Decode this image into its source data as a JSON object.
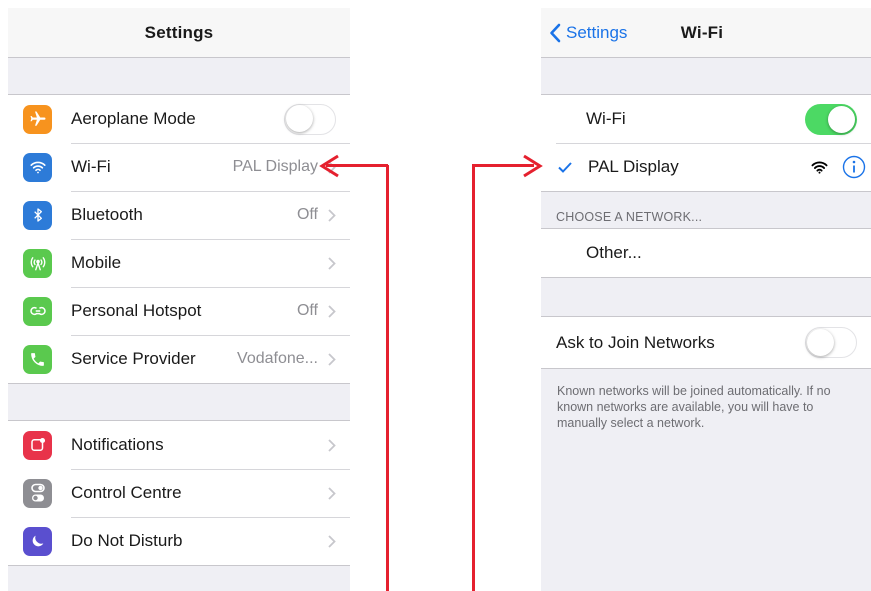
{
  "left": {
    "title": "Settings",
    "group1": [
      {
        "label": "Aeroplane Mode",
        "value": "",
        "icon": "airplane-icon",
        "color": "#f7931e",
        "control": "toggle-off"
      },
      {
        "label": "Wi-Fi",
        "value": "PAL Display",
        "icon": "wifi-icon",
        "color": "#2d7bd8",
        "control": "chevron"
      },
      {
        "label": "Bluetooth",
        "value": "Off",
        "icon": "bluetooth-icon",
        "color": "#2d7bd8",
        "control": "chevron"
      },
      {
        "label": "Mobile",
        "value": "",
        "icon": "antenna-icon",
        "color": "#5ac94e",
        "control": "chevron"
      },
      {
        "label": "Personal Hotspot",
        "value": "Off",
        "icon": "hotspot-icon",
        "color": "#5ac94e",
        "control": "chevron"
      },
      {
        "label": "Service Provider",
        "value": "Vodafone...",
        "icon": "phone-icon",
        "color": "#5ac94e",
        "control": "chevron"
      }
    ],
    "group2": [
      {
        "label": "Notifications",
        "value": "",
        "icon": "notifications-icon",
        "color": "#e8334a",
        "control": "chevron"
      },
      {
        "label": "Control Centre",
        "value": "",
        "icon": "switches-icon",
        "color": "#8e8e93",
        "control": "chevron"
      },
      {
        "label": "Do Not Disturb",
        "value": "",
        "icon": "moon-icon",
        "color": "#5a4fcf",
        "control": "chevron"
      }
    ]
  },
  "right": {
    "back_label": "Settings",
    "title": "Wi-Fi",
    "wifi_label": "Wi-Fi",
    "connected_network": "PAL Display",
    "choose_header": "CHOOSE A NETWORK...",
    "other_label": "Other...",
    "ask_label": "Ask to Join Networks",
    "footer": "Known networks will be joined automatically. If no known networks are available, you will have to manually select a network."
  },
  "colors": {
    "accent": "#1a73e8",
    "toggle_on": "#4cd964",
    "arrow": "#e5202e"
  }
}
